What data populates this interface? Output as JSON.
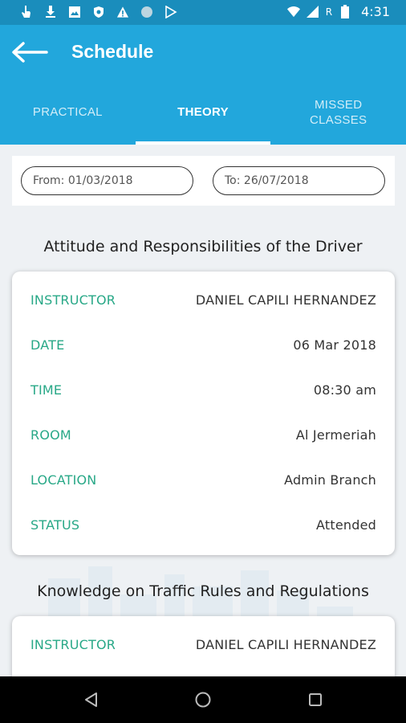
{
  "status_bar": {
    "left_icons": [
      "touch-icon",
      "download-icon",
      "image-icon",
      "shield-icon",
      "warning-icon",
      "circle-icon",
      "play-store-icon"
    ],
    "right_icons": [
      "wifi-icon",
      "signal-icon",
      "battery-icon"
    ],
    "roaming_label": "R",
    "time": "4:31"
  },
  "app_bar": {
    "title": "Schedule"
  },
  "tabs": [
    {
      "label": "PRACTICAL",
      "active": false
    },
    {
      "label": "THEORY",
      "active": true
    },
    {
      "label": "MISSED\nCLASSES",
      "active": false
    }
  ],
  "filter": {
    "from": "From: 01/03/2018",
    "to": "To: 26/07/2018"
  },
  "classes": [
    {
      "title": "Attitude and Responsibilities of the Driver",
      "rows": [
        {
          "label": "INSTRUCTOR",
          "value": "DANIEL CAPILI HERNANDEZ"
        },
        {
          "label": "DATE",
          "value": "06 Mar 2018"
        },
        {
          "label": "TIME",
          "value": "08:30 am"
        },
        {
          "label": "ROOM",
          "value": "Al Jermeriah"
        },
        {
          "label": "LOCATION",
          "value": "Admin Branch"
        },
        {
          "label": "STATUS",
          "value": "Attended"
        }
      ]
    },
    {
      "title": "Knowledge on Traffic Rules and Regulations",
      "rows": [
        {
          "label": "INSTRUCTOR",
          "value": "DANIEL CAPILI HERNANDEZ"
        }
      ]
    }
  ],
  "colors": {
    "status_bar": "#1a8dbc",
    "app_bar": "#22a7dc",
    "label_green": "#28a887",
    "nav_bar": "#000000"
  }
}
